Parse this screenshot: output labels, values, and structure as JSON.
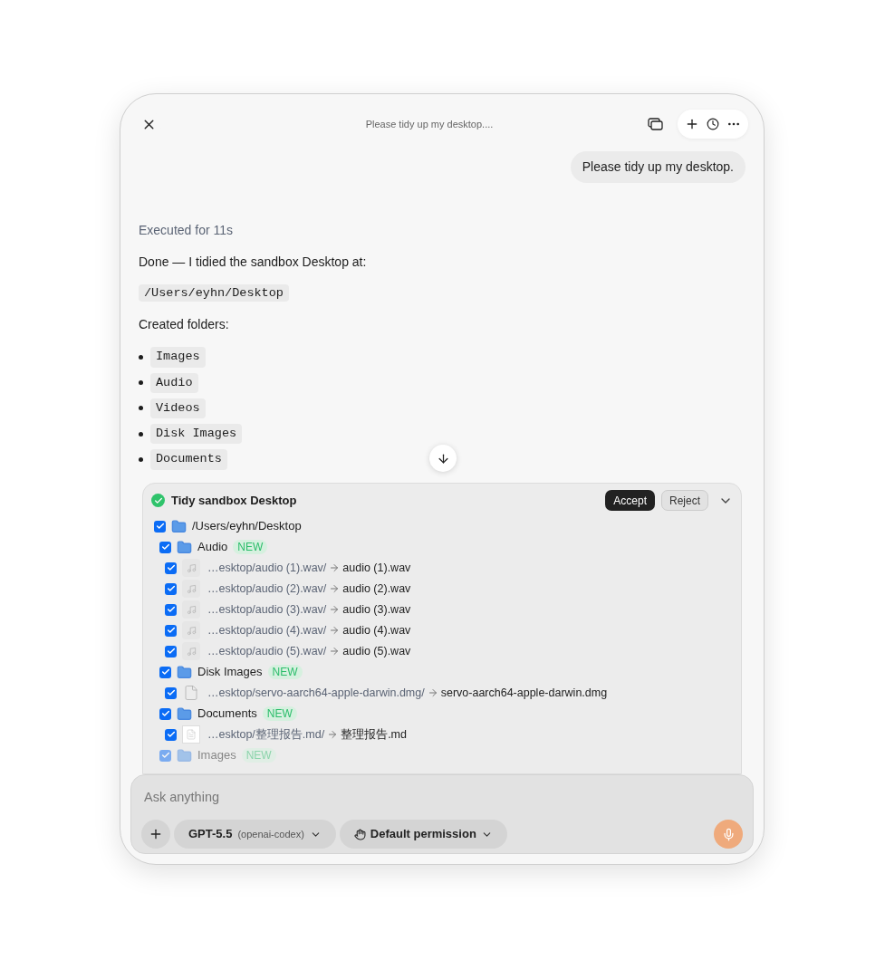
{
  "header": {
    "title": "Please tidy up my desktop...."
  },
  "user_message": "Please tidy up my desktop.",
  "reply": {
    "status": "Executed for 11s",
    "intro": "Done — I tidied the sandbox Desktop at:",
    "path": "/Users/eyhn/Desktop",
    "folders_label": "Created folders:",
    "folders": [
      "Images",
      "Audio",
      "Videos",
      "Disk Images",
      "Documents"
    ]
  },
  "plan": {
    "title": "Tidy sandbox Desktop",
    "done": true,
    "accept": "Accept",
    "reject": "Reject",
    "tree": {
      "kind": "folder",
      "name": "/Users/eyhn/Desktop",
      "checked": true,
      "faded": false,
      "children": [
        {
          "kind": "folder",
          "name": "Audio",
          "badge": "NEW",
          "checked": true,
          "faded": false,
          "children": [
            {
              "kind": "audio_file",
              "from": "…esktop/audio (1).wav/",
              "to": "audio (1).wav",
              "checked": true
            },
            {
              "kind": "audio_file",
              "from": "…esktop/audio (2).wav/",
              "to": "audio (2).wav",
              "checked": true
            },
            {
              "kind": "audio_file",
              "from": "…esktop/audio (3).wav/",
              "to": "audio (3).wav",
              "checked": true
            },
            {
              "kind": "audio_file",
              "from": "…esktop/audio (4).wav/",
              "to": "audio (4).wav",
              "checked": true
            },
            {
              "kind": "audio_file",
              "from": "…esktop/audio (5).wav/",
              "to": "audio (5).wav",
              "checked": true
            }
          ]
        },
        {
          "kind": "folder",
          "name": "Disk Images",
          "badge": "NEW",
          "checked": true,
          "faded": false,
          "children": [
            {
              "kind": "disk_file",
              "from": "…esktop/servo-aarch64-apple-darwin.dmg/",
              "to": "servo-aarch64-apple-darwin.dmg",
              "checked": true
            }
          ]
        },
        {
          "kind": "folder",
          "name": "Documents",
          "badge": "NEW",
          "checked": true,
          "faded": false,
          "children": [
            {
              "kind": "document_file",
              "from": "…esktop/整理报告.md/",
              "to": "整理报告.md",
              "checked": true
            }
          ]
        },
        {
          "kind": "folder",
          "name": "Images",
          "badge": "NEW",
          "checked": true,
          "faded": true
        }
      ]
    }
  },
  "composer": {
    "placeholder": "Ask anything",
    "model": "GPT-5.5",
    "provider": "(openai-codex)",
    "permission": "Default permission"
  }
}
